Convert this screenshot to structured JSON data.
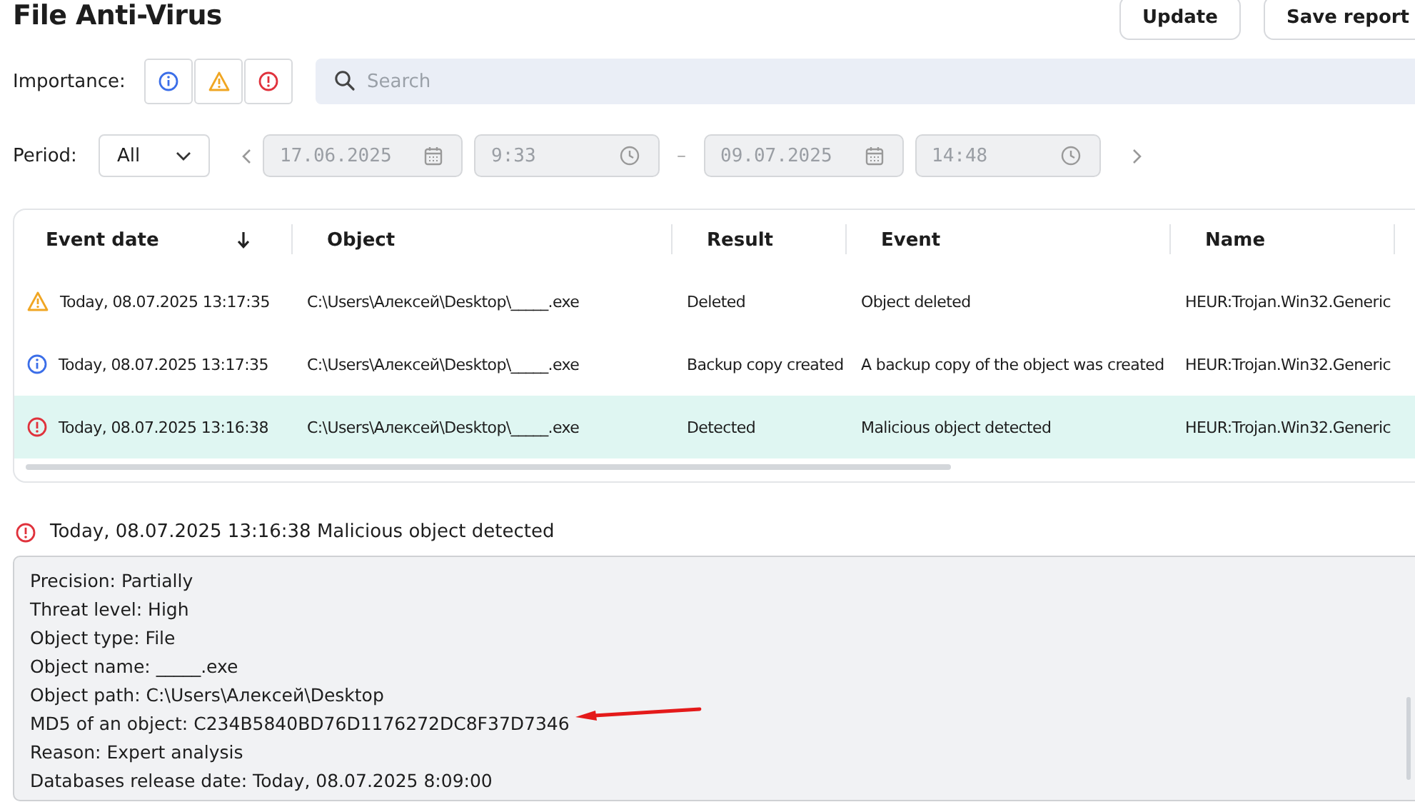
{
  "title": "File Anti-Virus",
  "buttons": [
    "Update",
    "Save report"
  ],
  "importance": {
    "label": "Importance:",
    "filters": [
      {
        "kind": "info"
      },
      {
        "kind": "warning"
      },
      {
        "kind": "error"
      }
    ]
  },
  "search": {
    "placeholder": "Search"
  },
  "period": {
    "label": "Period:",
    "value": "All",
    "from_date": "17.06.2025",
    "from_time": "9:33",
    "separator": "–",
    "to_date": "09.07.2025",
    "to_time": "14:48"
  },
  "table": {
    "columns": [
      {
        "label": "Event date",
        "sorted_descending": true
      },
      {
        "label": "Object"
      },
      {
        "label": "Result"
      },
      {
        "label": "Event"
      },
      {
        "label": "Name"
      }
    ],
    "rows": [
      {
        "kind": "warning",
        "selected": false,
        "cells": [
          "Today, 08.07.2025 13:17:35",
          "C:\\Users\\Алексей\\Desktop\\_____.exe",
          "Deleted",
          "Object deleted",
          "HEUR:Trojan.Win32.Generic"
        ]
      },
      {
        "kind": "info",
        "selected": false,
        "cells": [
          "Today, 08.07.2025 13:17:35",
          "C:\\Users\\Алексей\\Desktop\\_____.exe",
          "Backup copy created",
          "A backup copy of the object was created",
          "HEUR:Trojan.Win32.Generic"
        ]
      },
      {
        "kind": "error",
        "selected": true,
        "cells": [
          "Today, 08.07.2025 13:16:38",
          "C:\\Users\\Алексей\\Desktop\\_____.exe",
          "Detected",
          "Malicious object detected",
          "HEUR:Trojan.Win32.Generic"
        ]
      }
    ]
  },
  "details": {
    "kind": "error",
    "heading": "Today, 08.07.2025 13:16:38 Malicious object detected",
    "lines": [
      "Precision: Partially",
      "Threat level: High",
      "Object type: File",
      "Object name: _____.exe",
      "Object path: C:\\Users\\Алексей\\Desktop",
      "MD5 of an object: C234B5840BD76D1176272DC8F37D7346",
      "Reason: Expert analysis",
      "Databases release date: Today, 08.07.2025 8:09:00"
    ]
  }
}
